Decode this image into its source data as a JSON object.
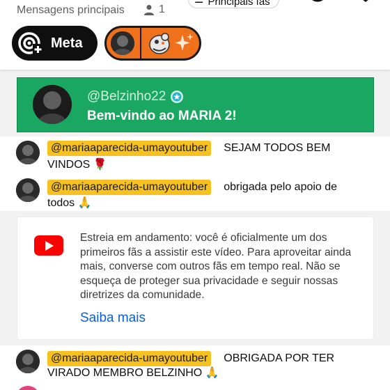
{
  "header": {
    "title": "Mensagens principais",
    "viewer_count": "1",
    "sort_label": "Principais fãs"
  },
  "chips": {
    "meta_label": "Meta"
  },
  "welcome": {
    "handle": "@Belzinho22",
    "message": "Bem-vindo ao MARIA 2!",
    "background": "#1aa761"
  },
  "messages": [
    {
      "author": "@mariaaparecida-umayoutuber",
      "text_line1": "SEJAM TODOS BEM",
      "text_line2": "VINDOS 🌹"
    },
    {
      "author": "@mariaaparecida-umayoutuber",
      "text_line1": "obrigada pelo apoio de",
      "text_line2": "todos 🙏"
    },
    {
      "author": "@mariaaparecida-umayoutuber",
      "text_line1": "OBRIGADA POR TER",
      "text_line2": "VIRADO MEMBRO BELZINHO 🙏"
    }
  ],
  "premiere": {
    "text": "Estreia em andamento: você é oficialmente um dos primeiros fãs a assistir este vídeo. Para aproveitar ainda mais, converse com outros fãs em tempo real. Não se esqueça de proteger sua privacidade e seguir nossas diretrizes da comunidade.",
    "link": "Saiba mais"
  },
  "colors": {
    "member_highlight": "#f7c11f",
    "link": "#0b5fd6",
    "youtube_red": "#ff0000"
  }
}
